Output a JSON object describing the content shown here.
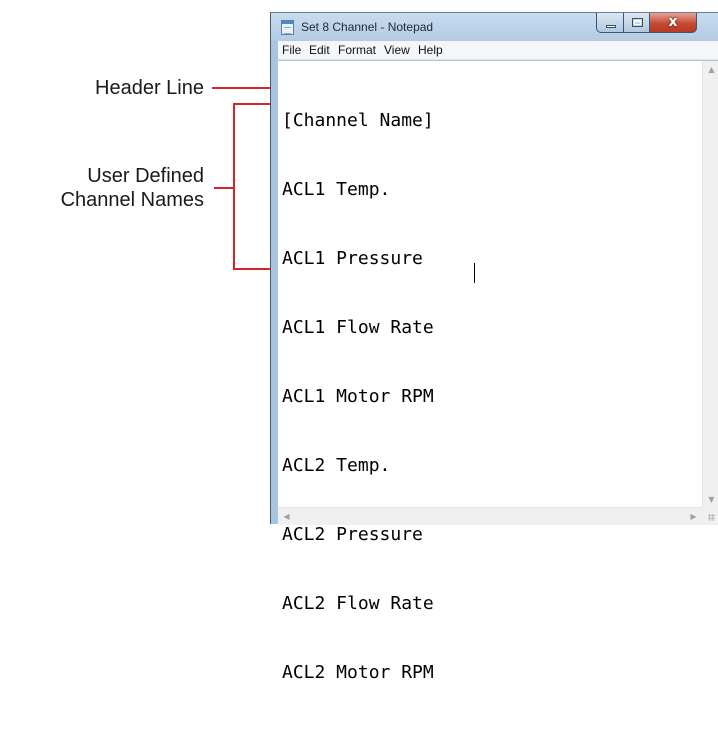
{
  "window": {
    "title": "Set 8 Channel - Notepad",
    "close_glyph": "x"
  },
  "menu": [
    "File",
    "Edit",
    "Format",
    "View",
    "Help"
  ],
  "document": {
    "lines": [
      "[Channel Name]",
      "ACL1 Temp.",
      "ACL1 Pressure",
      "ACL1 Flow Rate",
      "ACL1 Motor RPM",
      "ACL2 Temp.",
      "ACL2 Pressure",
      "ACL2 Flow Rate",
      "ACL2 Motor RPM"
    ]
  },
  "annotations": {
    "header_line": "Header Line",
    "user_defined": "User Defined\nChannel Names"
  },
  "colors": {
    "annotation_line": "#d8232a",
    "titlebar": "#b9d1ea"
  },
  "icons": {
    "app": "notepad-icon",
    "scroll_up": "scroll-up-arrow-icon",
    "scroll_down": "scroll-down-arrow-icon",
    "scroll_left": "scroll-left-arrow-icon",
    "scroll_right": "scroll-right-arrow-icon",
    "resize": "resize-grip-icon"
  }
}
